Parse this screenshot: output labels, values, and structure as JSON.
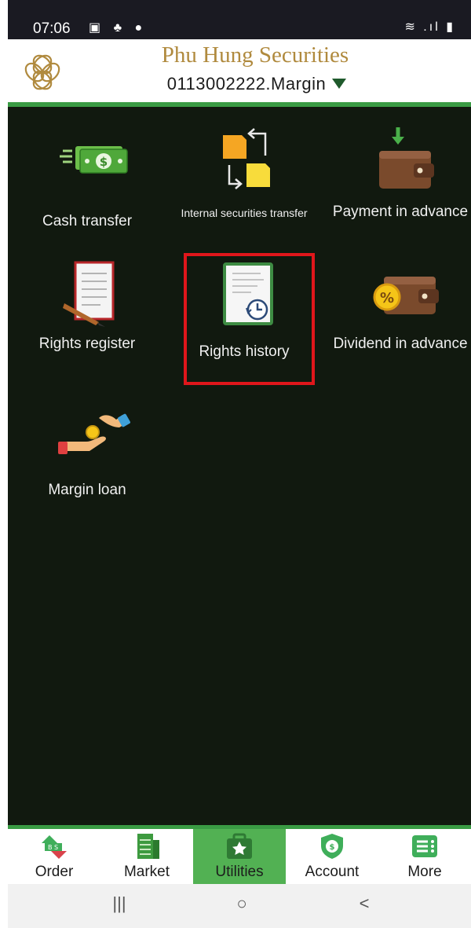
{
  "status_bar": {
    "time": "07:06",
    "icons_left": "▣ ♣ ●",
    "icons_right": "≋ .ıl ▮"
  },
  "header": {
    "brand": "Phu Hung Securities",
    "account": "0113002222.Margin",
    "logo_icon": "phs-logo-icon"
  },
  "tiles": [
    {
      "label": "Cash transfer",
      "icon": "cash-transfer-icon"
    },
    {
      "label": "Internal securities transfer",
      "icon": "internal-transfer-icon"
    },
    {
      "label": "Payment in advance",
      "icon": "wallet-download-icon"
    },
    {
      "label": "Rights register",
      "icon": "document-pen-icon"
    },
    {
      "label": "Rights history",
      "icon": "document-clock-icon"
    },
    {
      "label": "Dividend in advance",
      "icon": "wallet-percent-icon"
    },
    {
      "label": "Margin loan",
      "icon": "hand-coin-icon"
    }
  ],
  "bottom_nav": [
    {
      "label": "Order",
      "icon": "buy-sell-icon"
    },
    {
      "label": "Market",
      "icon": "market-board-icon"
    },
    {
      "label": "Utilities",
      "icon": "utilities-star-icon"
    },
    {
      "label": "Account",
      "icon": "account-shield-icon"
    },
    {
      "label": "More",
      "icon": "more-list-icon"
    }
  ],
  "active_tab": "Utilities",
  "system_nav": {
    "recents": "|||",
    "home": "○",
    "back": "<"
  },
  "colors": {
    "brand_gold": "#b08a3e",
    "accent_green": "#52b153",
    "background_dark": "#11190f",
    "highlight_red": "#e0161b"
  }
}
